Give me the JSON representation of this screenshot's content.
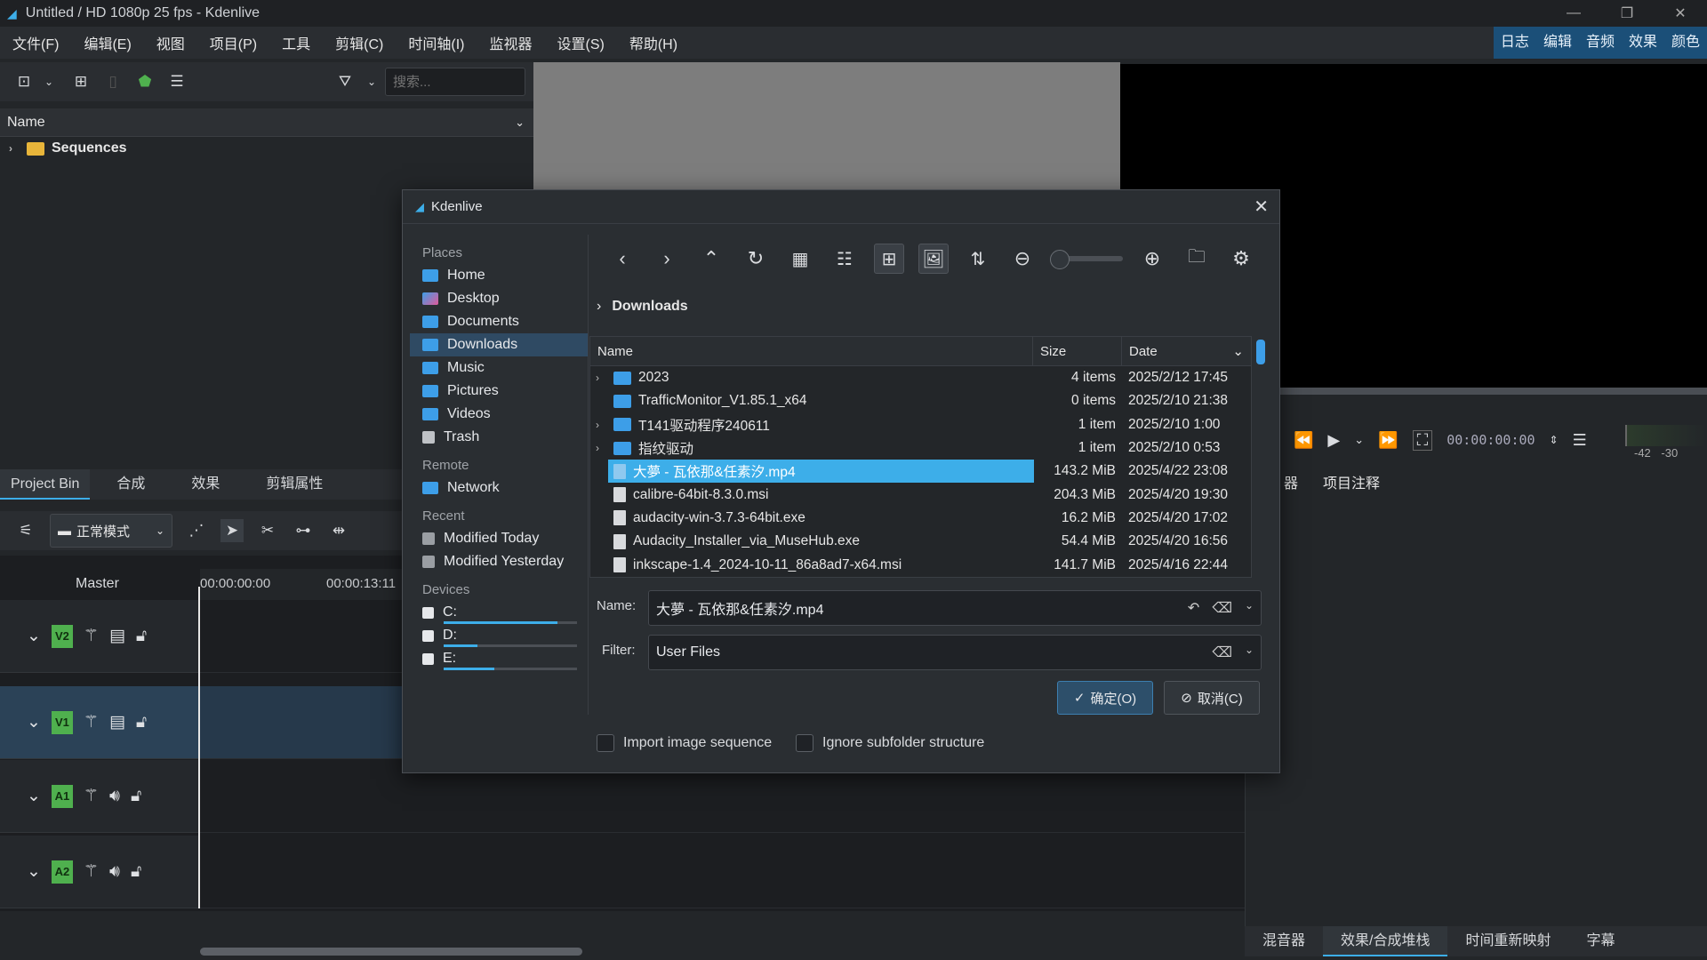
{
  "window": {
    "title": "Untitled / HD 1080p 25 fps - Kdenlive"
  },
  "menu": [
    "文件(F)",
    "编辑(E)",
    "视图",
    "项目(P)",
    "工具",
    "剪辑(C)",
    "时间轴(I)",
    "监视器",
    "设置(S)",
    "帮助(H)"
  ],
  "workspaces": [
    "日志",
    "编辑",
    "音频",
    "效果",
    "颜色"
  ],
  "bin": {
    "search_placeholder": "搜索...",
    "column_name": "Name",
    "items": [
      {
        "label": "Sequences"
      }
    ]
  },
  "bin_tabs": [
    "Project Bin",
    "合成",
    "效果",
    "剪辑属性"
  ],
  "right_tabs": [
    "器",
    "项目注释"
  ],
  "monitor": {
    "timecode": "00:00:00:00",
    "levels": [
      "-42",
      "-30"
    ]
  },
  "timeline": {
    "mode": "正常模式",
    "master": "Master",
    "ruler": [
      "00:00:00:00",
      "00:00:13:11"
    ],
    "tracks": [
      "V2",
      "V1",
      "A1",
      "A2"
    ]
  },
  "bottom_tabs": [
    "混音器",
    "效果/合成堆栈",
    "时间重新映射",
    "字幕"
  ],
  "dialog": {
    "title": "Kdenlive",
    "breadcrumb": "Downloads",
    "places": {
      "places_label": "Places",
      "places": [
        "Home",
        "Desktop",
        "Documents",
        "Downloads",
        "Music",
        "Pictures",
        "Videos",
        "Trash"
      ],
      "remote_label": "Remote",
      "remote": [
        "Network"
      ],
      "recent_label": "Recent",
      "recent": [
        "Modified Today",
        "Modified Yesterday"
      ],
      "devices_label": "Devices",
      "devices": [
        {
          "label": "C:",
          "usage": 0.85
        },
        {
          "label": "D:",
          "usage": 0.25
        },
        {
          "label": "E:",
          "usage": 0.38
        }
      ]
    },
    "columns": {
      "name": "Name",
      "size": "Size",
      "date": "Date"
    },
    "files": [
      {
        "name": "2023",
        "size": "4 items",
        "date": "2025/2/12 17:45",
        "type": "folder",
        "expandable": true
      },
      {
        "name": "TrafficMonitor_V1.85.1_x64",
        "size": "0 items",
        "date": "2025/2/10 21:38",
        "type": "folder",
        "expandable": false
      },
      {
        "name": "T141驱动程序240611",
        "size": "1 item",
        "date": "2025/2/10 1:00",
        "type": "folder",
        "expandable": true
      },
      {
        "name": "指纹驱动",
        "size": "1 item",
        "date": "2025/2/10 0:53",
        "type": "folder",
        "expandable": true
      },
      {
        "name": "大夢 - 瓦依那&任素汐.mp4",
        "size": "143.2 MiB",
        "date": "2025/4/22 23:08",
        "type": "file",
        "selected": true
      },
      {
        "name": "calibre-64bit-8.3.0.msi",
        "size": "204.3 MiB",
        "date": "2025/4/20 19:30",
        "type": "file"
      },
      {
        "name": "audacity-win-3.7.3-64bit.exe",
        "size": "16.2 MiB",
        "date": "2025/4/20 17:02",
        "type": "file"
      },
      {
        "name": "Audacity_Installer_via_MuseHub.exe",
        "size": "54.4 MiB",
        "date": "2025/4/20 16:56",
        "type": "file"
      },
      {
        "name": "inkscape-1.4_2024-10-11_86a8ad7-x64.msi",
        "size": "141.7 MiB",
        "date": "2025/4/16 22:44",
        "type": "file"
      }
    ],
    "name_label": "Name:",
    "name_value": "大夢 - 瓦依那&任素汐.mp4",
    "filter_label": "Filter:",
    "filter_value": "User Files",
    "ok_label": "确定(O)",
    "cancel_label": "取消(C)",
    "import_sequence_label": "Import image sequence",
    "ignore_subfolder_label": "Ignore subfolder structure"
  },
  "colors": {
    "accent": "#3daee9",
    "track_tag": "#4fb04e",
    "folder_yellow": "#e8b53a"
  }
}
